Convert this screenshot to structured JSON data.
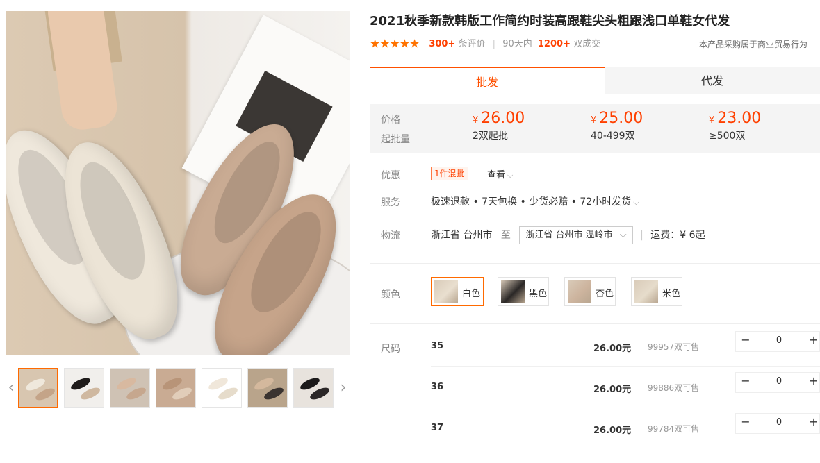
{
  "product": {
    "title": "2021秋季新款韩版工作简约时装高跟鞋尖头粗跟浅口单鞋女代发",
    "stars": "★★★★★",
    "review_count": "300+",
    "review_label": "条评价",
    "sales_period": "90天内",
    "sales_count": "1200+",
    "sales_unit": "双成交",
    "trade_note": "本产品采购属于商业贸易行为"
  },
  "tabs": [
    {
      "label": "批发",
      "active": true
    },
    {
      "label": "代发",
      "active": false
    }
  ],
  "pricing": {
    "price_label": "价格",
    "moq_label": "起批量",
    "currency": "¥",
    "tiers": [
      {
        "price": "26.00",
        "qty": "2双起批"
      },
      {
        "price": "25.00",
        "qty": "40-499双"
      },
      {
        "price": "23.00",
        "qty": "≥500双"
      }
    ]
  },
  "promo": {
    "label": "优惠",
    "tag": "1件混批",
    "view": "查看"
  },
  "service": {
    "label": "服务",
    "text": "极速退款 • 7天包换 • 少货必赔 • 72小时发货"
  },
  "logistics": {
    "label": "物流",
    "origin": "浙江省 台州市",
    "to": "至",
    "destination": "浙江省 台州市 温岭市",
    "shipping": "运费：¥ 6起"
  },
  "colors": {
    "label": "颜色",
    "options": [
      {
        "name": "白色",
        "selected": true,
        "swatch": "#e9dfcf"
      },
      {
        "name": "黑色",
        "selected": false,
        "swatch": "#2a2726"
      },
      {
        "name": "杏色",
        "selected": false,
        "swatch": "#cdb49e"
      },
      {
        "name": "米色",
        "selected": false,
        "swatch": "#e6dccb"
      }
    ]
  },
  "sizes": {
    "label": "尺码",
    "rows": [
      {
        "size": "35",
        "price": "26.00元",
        "stock": "99957双可售",
        "qty": "0"
      },
      {
        "size": "36",
        "price": "26.00元",
        "stock": "99886双可售",
        "qty": "0"
      },
      {
        "size": "37",
        "price": "26.00元",
        "stock": "99784双可售",
        "qty": "0"
      }
    ]
  },
  "stepper": {
    "minus": "−",
    "plus": "+"
  },
  "gallery": {
    "prev": "‹",
    "next": "›",
    "thumbs": [
      {
        "bg": "#d8c6b0",
        "a": "#efe8dc",
        "b": "#c4a488",
        "selected": true
      },
      {
        "bg": "#f1efec",
        "a": "#1f1c1b",
        "b": "#cfb8a0",
        "selected": false
      },
      {
        "bg": "#cfc2b4",
        "a": "#d8b9a0",
        "b": "#c6a78e",
        "selected": false
      },
      {
        "bg": "#c9ab93",
        "a": "#b89478",
        "b": "#e1cdb9",
        "selected": false
      },
      {
        "bg": "#ffffff",
        "a": "#f0e7da",
        "b": "#e6dccb",
        "selected": false
      },
      {
        "bg": "#b9a48b",
        "a": "#d4b89d",
        "b": "#3a3330",
        "selected": false
      },
      {
        "bg": "#e8e3dd",
        "a": "#1c1a1a",
        "b": "#2b2727",
        "selected": false
      }
    ]
  }
}
